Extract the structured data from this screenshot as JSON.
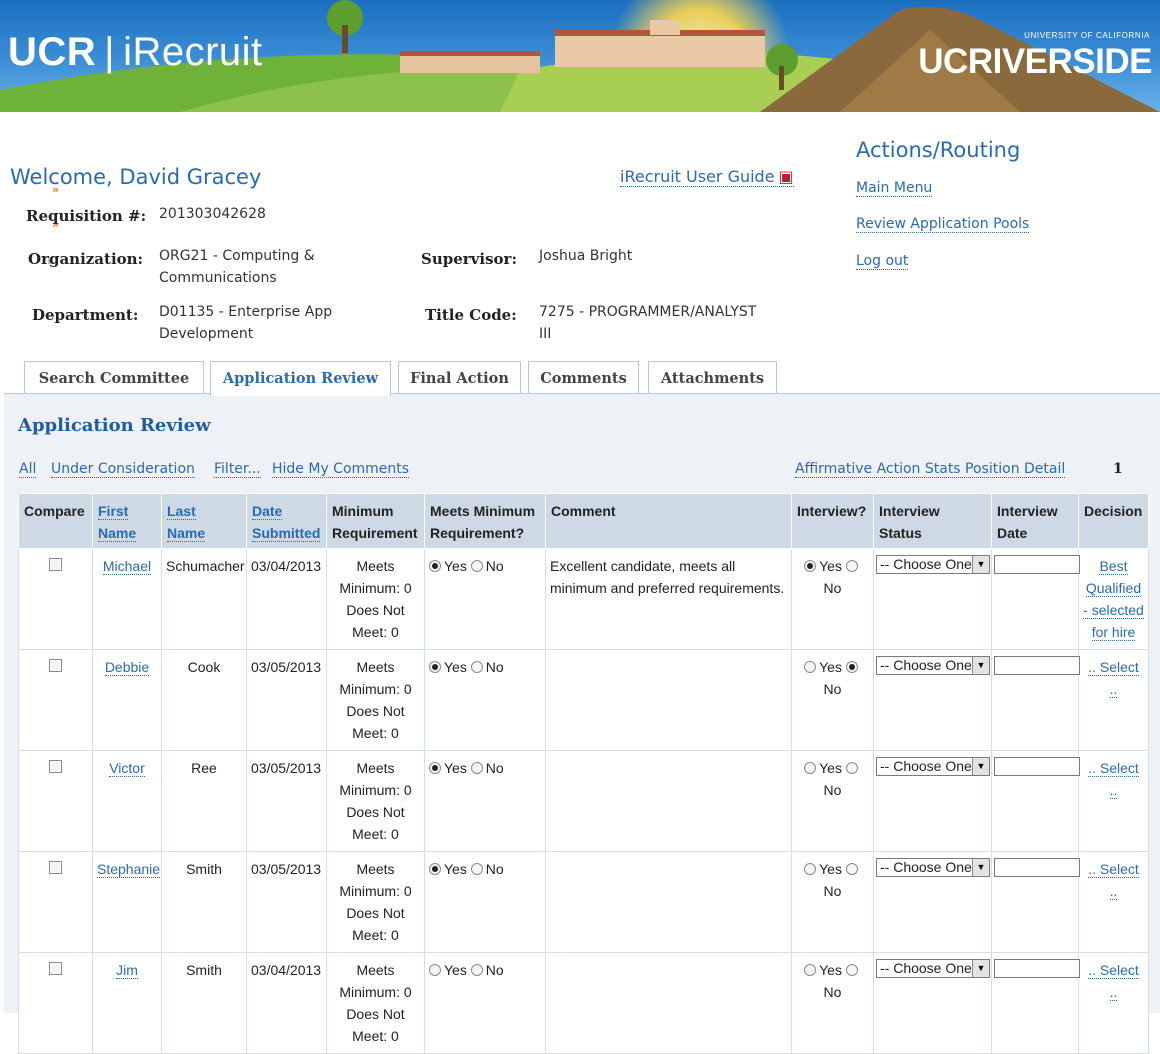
{
  "banner": {
    "ucr": "UCR",
    "separator": "|",
    "app_name": "iRecruit",
    "right_logo": "UCRIVERSIDE",
    "right_sub": "UNIVERSITY OF CALIFORNIA"
  },
  "header": {
    "welcome": "Welcome, David Gracey",
    "user_guide": "iRecruit User Guide",
    "user_guide_icon": "pdf-icon"
  },
  "actions": {
    "title": "Actions/Routing",
    "links": [
      "Main Menu",
      "Review Application Pools",
      "Log out"
    ]
  },
  "requisition": {
    "req_label": "Requisition #:",
    "req_value": "201303042628",
    "org_label": "Organization:",
    "org_value_1": "ORG21 - Computing &",
    "org_value_2": "Communications",
    "dept_label": "Department:",
    "dept_value_1": "D01135 - Enterprise App",
    "dept_value_2": "Development",
    "sup_label": "Supervisor:",
    "sup_value": "Joshua Bright",
    "title_label": "Title Code:",
    "title_value_1": "7275 - PROGRAMMER/ANALYST",
    "title_value_2": "III"
  },
  "tabs": [
    "Search Committee",
    "Application Review",
    "Final Action",
    "Comments",
    "Attachments"
  ],
  "active_tab": "Application Review",
  "panel": {
    "title": "Application Review",
    "filters": [
      "All",
      "Under Consideration",
      "Filter...",
      "Hide My Comments"
    ],
    "stats_link": "Affirmative Action Stats Position Detail",
    "page_number": "1"
  },
  "table": {
    "headers": {
      "compare": "Compare",
      "first_1": "First",
      "first_2": "Name",
      "last_1": "Last",
      "last_2": "Name",
      "date_1": "Date",
      "date_2": "Submitted",
      "min_1": "Minimum",
      "min_2": "Requirement",
      "meets_1": "Meets Minimum",
      "meets_2": "Requirement?",
      "comment": "Comment",
      "interview": "Interview?",
      "istatus_1": "Interview",
      "istatus_2": "Status",
      "idate_1": "Interview",
      "idate_2": "Date",
      "decision": "Decision"
    },
    "yes": "Yes",
    "no": "No",
    "choose": "-- Choose One --",
    "rows": [
      {
        "first": "Michael",
        "last": "Schumacher",
        "date": "03/04/2013",
        "req_1": "Meets",
        "req_2": "Minimum: 0",
        "req_3": "Does Not",
        "req_4": "Meet: 0",
        "meets": "yes",
        "comment": "Excellent candidate, meets all minimum and preferred requirements.",
        "interview": "yes",
        "decision": "Best Qualified - selected for hire"
      },
      {
        "first": "Debbie",
        "last": "Cook",
        "date": "03/05/2013",
        "req_1": "Meets",
        "req_2": "Minimum: 0",
        "req_3": "Does Not",
        "req_4": "Meet: 0",
        "meets": "yes",
        "comment": "",
        "interview": "no",
        "decision": ".. Select .."
      },
      {
        "first": "Victor",
        "last": "Ree",
        "date": "03/05/2013",
        "req_1": "Meets",
        "req_2": "Minimum: 0",
        "req_3": "Does Not",
        "req_4": "Meet: 0",
        "meets": "yes",
        "comment": "",
        "interview": "none",
        "decision": ".. Select .."
      },
      {
        "first": "Stephanie",
        "last": "Smith",
        "date": "03/05/2013",
        "req_1": "Meets",
        "req_2": "Minimum: 0",
        "req_3": "Does Not",
        "req_4": "Meet: 0",
        "meets": "yes",
        "comment": "",
        "interview": "none",
        "decision": ".. Select .."
      },
      {
        "first": "Jim",
        "last": "Smith",
        "date": "03/04/2013",
        "req_1": "Meets",
        "req_2": "Minimum: 0",
        "req_3": "Does Not",
        "req_4": "Meet: 0",
        "meets": "none",
        "comment": "",
        "interview": "none",
        "decision": ".. Select .."
      }
    ]
  },
  "colors": {
    "link": "#2a6ab0",
    "header_bg": "#cdd9e4",
    "panel_bg": "#eef2f6",
    "accent_orange": "#e8762b"
  }
}
